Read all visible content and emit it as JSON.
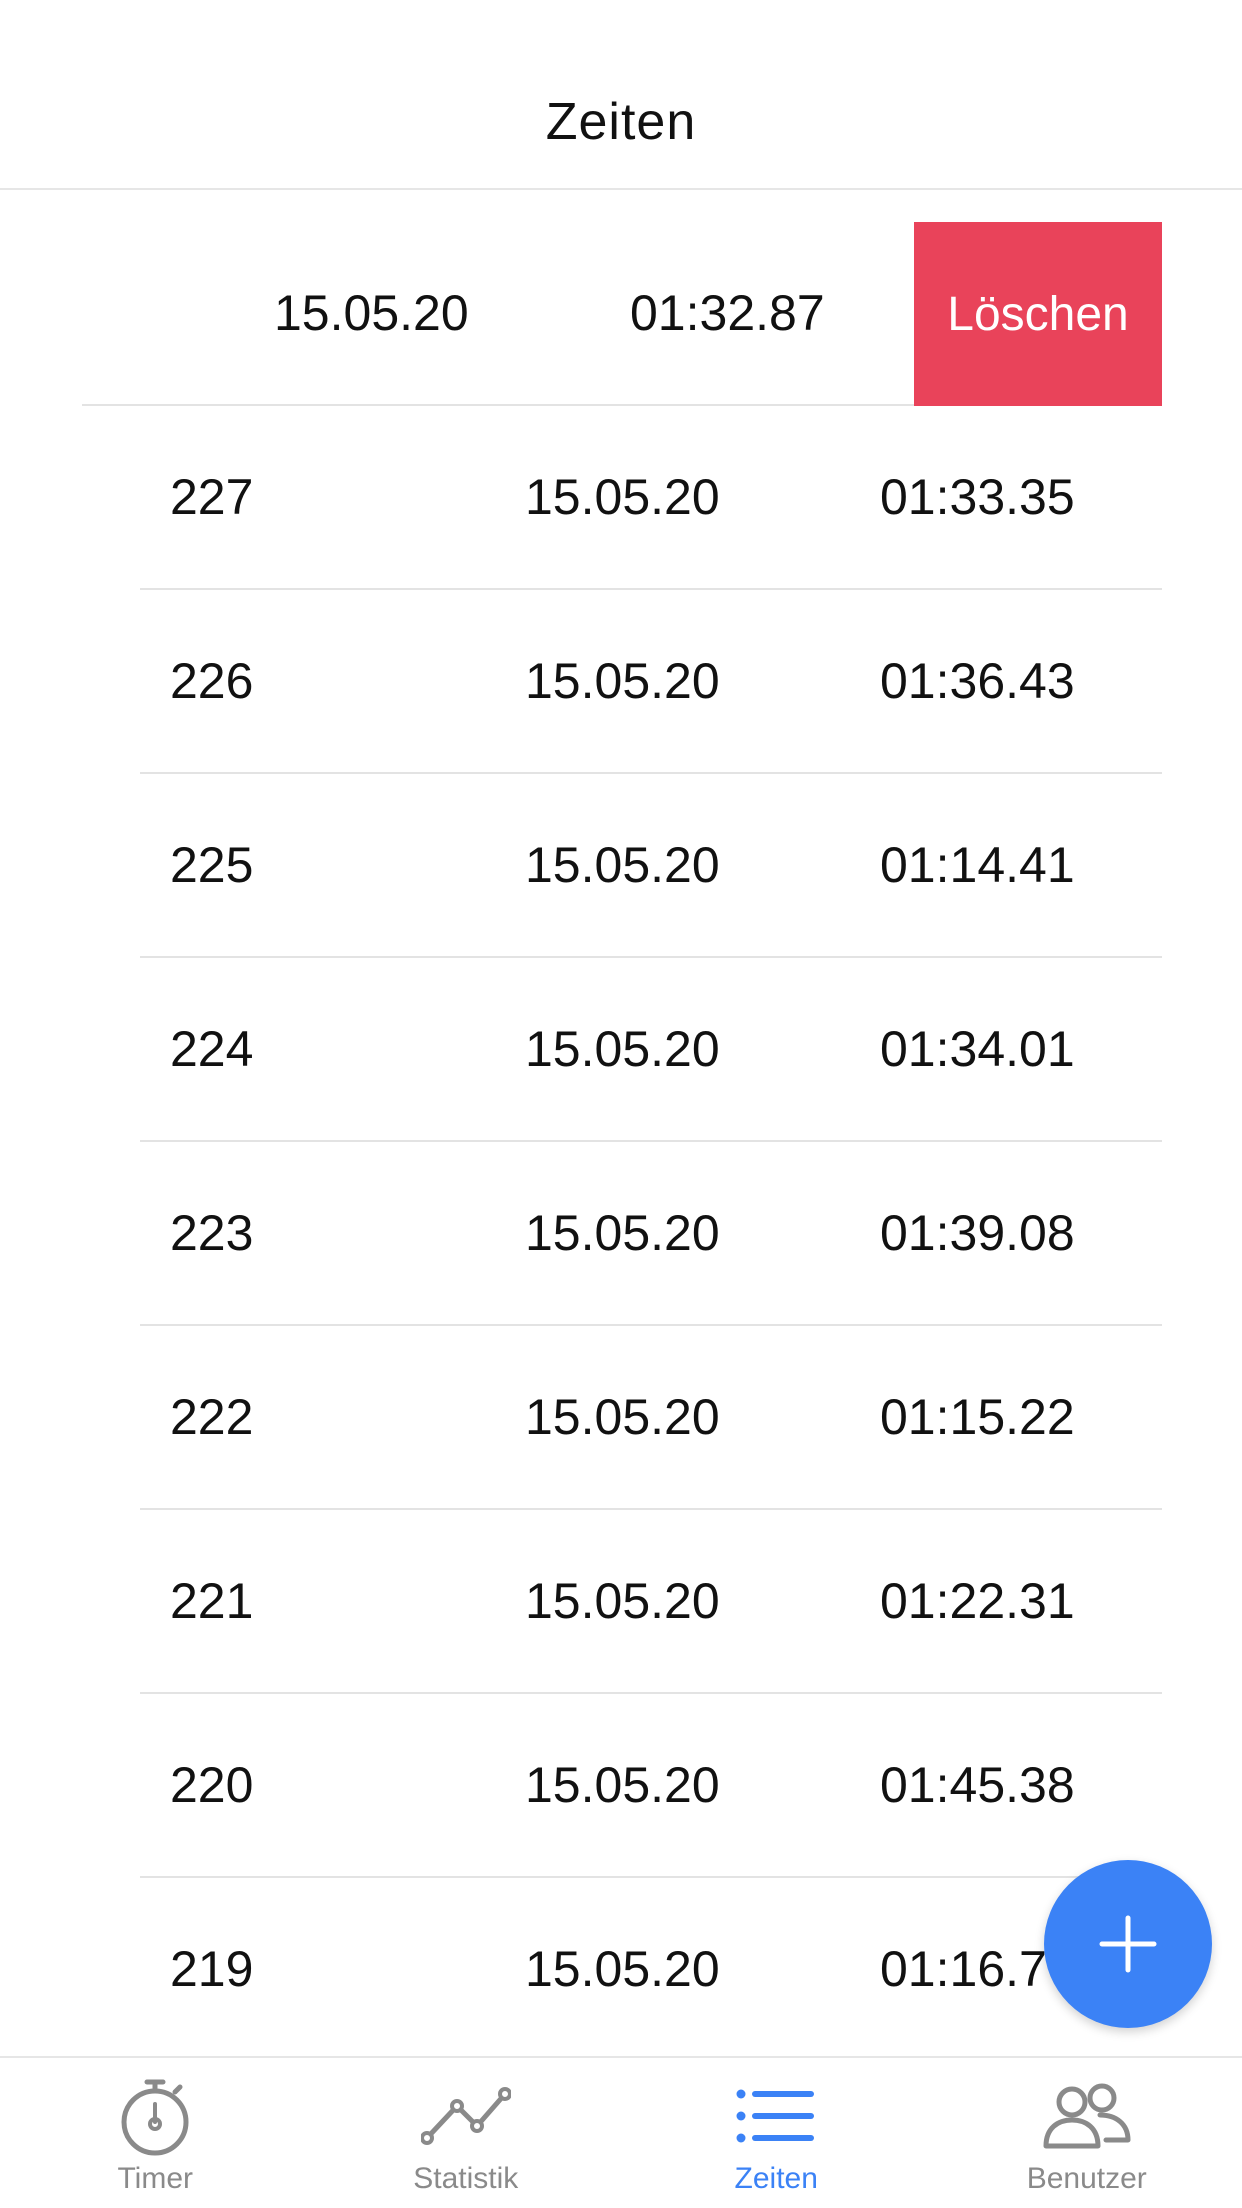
{
  "header": {
    "title": "Zeiten"
  },
  "swiped_row": {
    "date": "15.05.20",
    "time": "01:32.87",
    "delete_label": "Löschen"
  },
  "rows": [
    {
      "id": "227",
      "date": "15.05.20",
      "time": "01:33.35"
    },
    {
      "id": "226",
      "date": "15.05.20",
      "time": "01:36.43"
    },
    {
      "id": "225",
      "date": "15.05.20",
      "time": "01:14.41"
    },
    {
      "id": "224",
      "date": "15.05.20",
      "time": "01:34.01"
    },
    {
      "id": "223",
      "date": "15.05.20",
      "time": "01:39.08"
    },
    {
      "id": "222",
      "date": "15.05.20",
      "time": "01:15.22"
    },
    {
      "id": "221",
      "date": "15.05.20",
      "time": "01:22.31"
    },
    {
      "id": "220",
      "date": "15.05.20",
      "time": "01:45.38"
    },
    {
      "id": "219",
      "date": "15.05.20",
      "time": "01:16.7"
    }
  ],
  "fab": {
    "icon": "plus-icon"
  },
  "tabbar": {
    "tabs": [
      {
        "label": "Timer",
        "icon": "stopwatch-icon",
        "active": false
      },
      {
        "label": "Statistik",
        "icon": "line-chart-icon",
        "active": false
      },
      {
        "label": "Zeiten",
        "icon": "list-icon",
        "active": true
      },
      {
        "label": "Benutzer",
        "icon": "users-icon",
        "active": false
      }
    ]
  },
  "colors": {
    "accent": "#3b82f6",
    "delete": "#e9435a",
    "inactive": "#8a8a8a"
  }
}
